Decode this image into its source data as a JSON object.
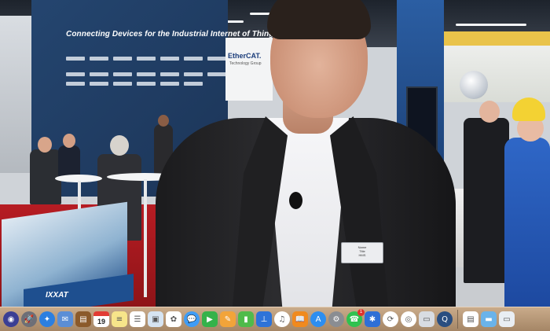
{
  "video": {
    "booth_headline": "Connecting Devices for the Industrial Internet of Things",
    "ethercat_logo": "EtherCAT.",
    "ethercat_sub": "Technology Group",
    "brochure_brand": "IXXAT",
    "badge_lines": [
      "Name",
      "Title",
      "HMS"
    ]
  },
  "dock": {
    "apps": [
      {
        "id": "siri",
        "color": "#3b3f94",
        "icon": "siri-icon",
        "glyph": "◉",
        "round": true
      },
      {
        "id": "launchpad",
        "color": "#6d6f77",
        "icon": "launchpad-icon",
        "glyph": "🚀",
        "round": true
      },
      {
        "id": "safari",
        "color": "#2c7fe0",
        "icon": "safari-icon",
        "glyph": "✦",
        "round": true
      },
      {
        "id": "mail-photo",
        "color": "#5b8ed6",
        "icon": "mail-icon",
        "glyph": "✉"
      },
      {
        "id": "notes-brown",
        "color": "#8b5a2b",
        "icon": "contacts-icon",
        "glyph": "▤"
      },
      {
        "id": "calendar",
        "color": "#ffffff",
        "icon": "calendar-icon",
        "calendar": "19"
      },
      {
        "id": "notes",
        "color": "#f7e58a",
        "icon": "notes-icon",
        "glyph": "≡"
      },
      {
        "id": "reminders",
        "color": "#ffffff",
        "icon": "reminders-icon",
        "glyph": "☰"
      },
      {
        "id": "preview",
        "color": "#d6e4f2",
        "icon": "preview-icon",
        "glyph": "▣"
      },
      {
        "id": "photos",
        "color": "#ffffff",
        "icon": "photos-icon",
        "glyph": "✿"
      },
      {
        "id": "messages",
        "color": "#3f9cf5",
        "icon": "messages-icon",
        "glyph": "💬",
        "round": true
      },
      {
        "id": "facetime",
        "color": "#35b24a",
        "icon": "facetime-icon",
        "glyph": "▶"
      },
      {
        "id": "pages",
        "color": "#f2a43a",
        "icon": "pages-icon",
        "glyph": "✎"
      },
      {
        "id": "numbers",
        "color": "#4fbb4a",
        "icon": "numbers-icon",
        "glyph": "▮"
      },
      {
        "id": "keynote",
        "color": "#2e73d8",
        "icon": "keynote-icon",
        "glyph": "⊥"
      },
      {
        "id": "itunes",
        "color": "#ffffff",
        "icon": "music-icon",
        "glyph": "♫",
        "round": true
      },
      {
        "id": "ibooks",
        "color": "#f08a1e",
        "icon": "books-icon",
        "glyph": "📖"
      },
      {
        "id": "appstore",
        "color": "#2d8ef0",
        "icon": "app-store-icon",
        "glyph": "A",
        "round": true
      },
      {
        "id": "sysprefs",
        "color": "#8a8d92",
        "icon": "settings-icon",
        "glyph": "⚙",
        "round": true
      },
      {
        "id": "whatsapp",
        "color": "#2fc24f",
        "icon": "whatsapp-icon",
        "glyph": "☎",
        "round": true,
        "badge": "1"
      },
      {
        "id": "bluetooth",
        "color": "#2f6fd6",
        "icon": "bluetooth-icon",
        "glyph": "✱"
      },
      {
        "id": "sync",
        "color": "#ffffff",
        "icon": "sync-icon",
        "glyph": "⟳",
        "round": true
      },
      {
        "id": "chrome",
        "color": "#ffffff",
        "icon": "chrome-icon",
        "glyph": "◎",
        "round": true
      },
      {
        "id": "screenflow",
        "color": "#d8dce2",
        "icon": "screenflow-icon",
        "glyph": "▭"
      },
      {
        "id": "quicktime",
        "color": "#2a4e80",
        "icon": "quicktime-icon",
        "glyph": "Q",
        "round": true
      }
    ],
    "stacks": [
      {
        "id": "finder-window",
        "color": "#ffffff",
        "icon": "finder-window-icon",
        "glyph": "▤"
      },
      {
        "id": "folder",
        "color": "#6ab3ea",
        "icon": "folder-icon",
        "glyph": "▬"
      },
      {
        "id": "trash",
        "color": "#e9eef3",
        "icon": "trash-icon",
        "glyph": "▭"
      }
    ]
  }
}
